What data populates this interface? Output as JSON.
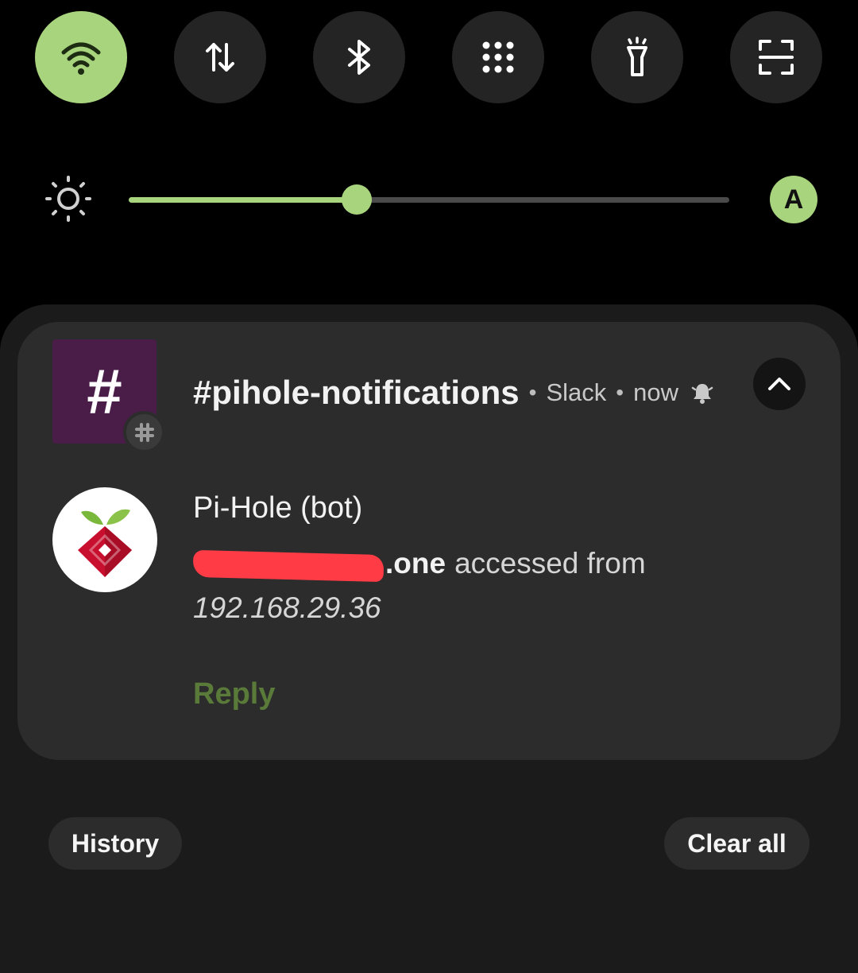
{
  "quick_settings": {
    "tiles": [
      {
        "icon": "wifi-icon",
        "active": true
      },
      {
        "icon": "mobile-data-icon",
        "active": false
      },
      {
        "icon": "bluetooth-icon",
        "active": false
      },
      {
        "icon": "apps-grid-icon",
        "active": false
      },
      {
        "icon": "flashlight-icon",
        "active": false
      },
      {
        "icon": "qr-scan-icon",
        "active": false
      }
    ],
    "accent_color": "#a8d47e"
  },
  "brightness": {
    "level_fraction": 0.38,
    "auto_label": "A"
  },
  "notification": {
    "channel_glyph": "#",
    "channel_name": "#pihole-notifications",
    "separator": "•",
    "app_name": "Slack",
    "time": "now",
    "sender": "Pi-Hole (bot)",
    "message_domain_suffix": ".one",
    "message_text": "accessed from",
    "message_ip": "192.168.29.36",
    "reply_label": "Reply"
  },
  "footer": {
    "history_label": "History",
    "clear_all_label": "Clear all"
  }
}
